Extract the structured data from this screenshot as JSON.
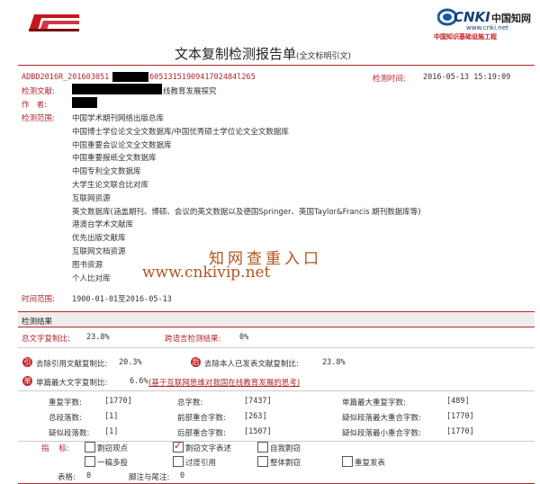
{
  "header": {
    "left_logo_text": "AMLC",
    "right_logo_text": "CNKI",
    "right_logo_cn": "中国知网",
    "right_logo_url": "www.cnki.net",
    "right_logo_sub": "中国知识基础设施工程",
    "title": "文本复制检测报告单",
    "title_suffix": "(全文标明引文)"
  },
  "report": {
    "id_left": "ADBD2016R_201603051",
    "id_right": "6051315190941702484l265",
    "time_label": "检测时间:",
    "time_value": "2016-05-13 15:19:09",
    "doc_label": "检测文献:",
    "doc_title_suffix": "线教育发展探究",
    "author_label": "作   者:",
    "scope_label": "检测范围:",
    "scope": [
      "中国学术期刊网络出版总库",
      "中国博士学位论文全文数据库/中国优秀硕士学位论文全文数据库",
      "中国重要会议论文全文数据库",
      "中国重要报纸全文数据库",
      "中国专利全文数据库",
      "大学生论文联合比对库",
      "互联网资源",
      "英文数据库(涵盖期刊、博硕、会议的英文数据以及德国Springer、英国Taylor&Francis 期刊数据库等)",
      "港澳台学术文献库",
      "优先出版文献库",
      "互联网文档资源",
      "图书资源",
      "个人比对库"
    ],
    "range_label": "时间范围:",
    "range_value": "1900-01-01至2016-05-13"
  },
  "watermark": {
    "line1": "知网查重入口",
    "line2": "www.cnkivip.net"
  },
  "results": {
    "section_title": "检测结果",
    "total_copy_label": "总文字复制比:",
    "total_copy_value": "23.8%",
    "cross_lang_label": "跨语言检测结果:",
    "cross_lang_value": "0%",
    "badge_left": "引",
    "excl_cite_label": "去除引用文献复制比:",
    "excl_cite_value": "20.3%",
    "badge_right": "后",
    "excl_self_label": "去除本人已发表文献复制比:",
    "excl_self_value": "23.8%",
    "badge_single": "单",
    "max_single_label": "单篇最大文字复制比:",
    "max_single_value": "6.6%",
    "max_single_source": "(基于互联网思维对我国在线教育发展的思考)",
    "stats": [
      {
        "label": "重复字数:",
        "value": "[1770]"
      },
      {
        "label": "总字数:",
        "value": "[7437]"
      },
      {
        "label": "单篇最大重复字数:",
        "value": "[489]"
      },
      {
        "label": "总段落数:",
        "value": "[1]"
      },
      {
        "label": "前部重合字数:",
        "value": "[263]"
      },
      {
        "label": "疑似段落最大重合字数:",
        "value": "[1770]"
      },
      {
        "label": "疑似段落数:",
        "value": "[1]"
      },
      {
        "label": "后部重合字数:",
        "value": "[1507]"
      },
      {
        "label": "疑似段落最小重合字数:",
        "value": "[1770]"
      }
    ],
    "indicator_label": "指    标:",
    "indicators": [
      {
        "label": "剽窃观点",
        "checked": false
      },
      {
        "label": "剽窃文字表述",
        "checked": true
      },
      {
        "label": "自我剽窃",
        "checked": false
      },
      {
        "label": "一稿多投",
        "checked": false
      },
      {
        "label": "过度引用",
        "checked": false
      },
      {
        "label": "整体剽窃",
        "checked": false
      },
      {
        "label": "重复发表",
        "checked": false
      }
    ],
    "tables_label": "表格:",
    "tables_value": "0",
    "footnotes_label": "脚注与尾注:",
    "footnotes_value": "0"
  }
}
